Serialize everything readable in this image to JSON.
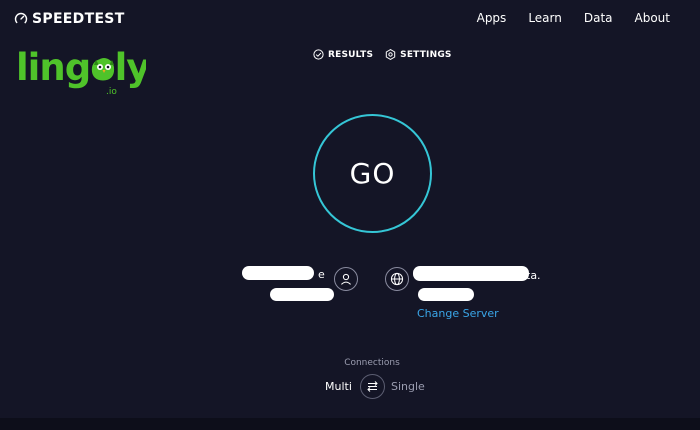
{
  "header": {
    "brand": "SPEEDTEST",
    "nav": [
      "Apps",
      "Learn",
      "Data",
      "About"
    ]
  },
  "logo": {
    "text": "lingoly",
    "suffix": ".io",
    "color": "#4fc32a"
  },
  "subnav": {
    "results": "RESULTS",
    "settings": "SETTINGS"
  },
  "go": {
    "label": "GO",
    "ring_color": "#35c6d6"
  },
  "isp": {
    "label": "e",
    "icon": "user-icon"
  },
  "server": {
    "label": "ta.",
    "icon": "globe-icon",
    "change": "Change Server",
    "link_color": "#3aa6e8"
  },
  "connections": {
    "label": "Connections",
    "multi": "Multi",
    "single": "Single",
    "icon": "swap-arrows-icon"
  }
}
